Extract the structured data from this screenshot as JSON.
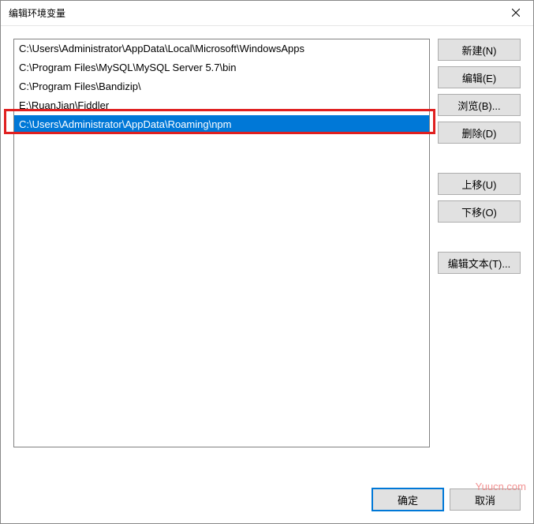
{
  "title": "编辑环境变量",
  "paths": [
    "C:\\Users\\Administrator\\AppData\\Local\\Microsoft\\WindowsApps",
    "C:\\Program Files\\MySQL\\MySQL Server 5.7\\bin",
    "C:\\Program Files\\Bandizip\\",
    "E:\\RuanJian\\Fiddler",
    "C:\\Users\\Administrator\\AppData\\Roaming\\npm"
  ],
  "selected_index": 4,
  "buttons": {
    "new": "新建(N)",
    "edit": "编辑(E)",
    "browse": "浏览(B)...",
    "delete": "删除(D)",
    "move_up": "上移(U)",
    "move_down": "下移(O)",
    "edit_text": "编辑文本(T)...",
    "ok": "确定",
    "cancel": "取消"
  },
  "watermark": "Yuucn.com"
}
